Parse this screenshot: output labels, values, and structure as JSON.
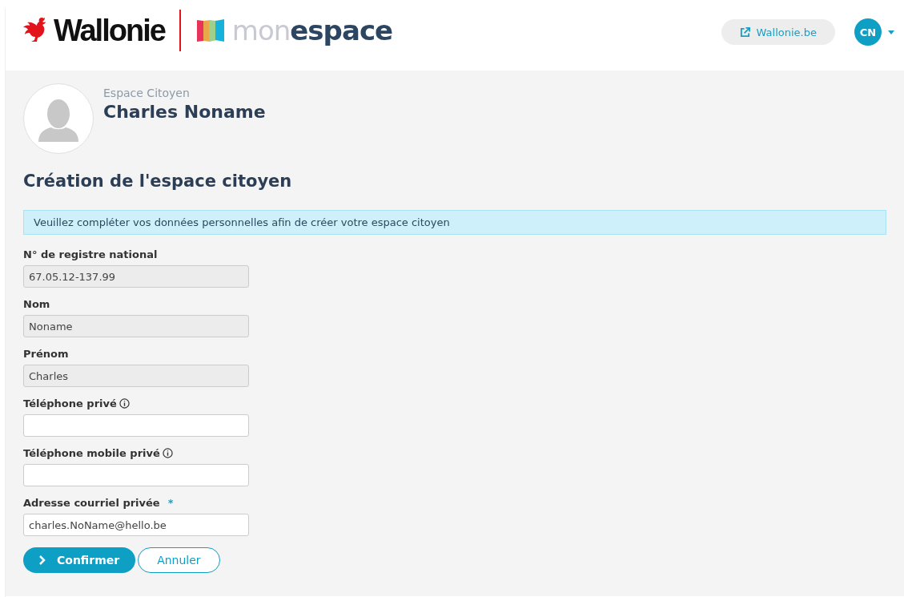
{
  "header": {
    "brand": "Wallonie",
    "app_name_light": "mon",
    "app_name_bold": "espace",
    "link": "Wallonie.be",
    "avatar": "CN"
  },
  "profile": {
    "space": "Espace Citoyen",
    "name": "Charles Noname"
  },
  "title": "Création de l'espace citoyen",
  "notice": "Veuillez compléter vos données personnelles afin de créer votre espace citoyen",
  "fields": [
    {
      "label": "N° de registre national",
      "value": "67.05.12-137.99",
      "disabled": true,
      "info": false,
      "required": false
    },
    {
      "label": "Nom",
      "value": "Noname",
      "disabled": true,
      "info": false,
      "required": false
    },
    {
      "label": "Prénom",
      "value": "Charles",
      "disabled": true,
      "info": false,
      "required": false
    },
    {
      "label": "Téléphone privé",
      "disabled": false,
      "info": true,
      "required": false
    },
    {
      "label": "Téléphone mobile privé",
      "disabled": false,
      "info": true,
      "required": false
    },
    {
      "label": "Adresse courriel privée",
      "value": "charles.NoName@hello.be",
      "disabled": false,
      "info": false,
      "required": true
    }
  ],
  "required_mark": "*",
  "buttons": [
    {
      "label": "Confirmer",
      "kind": "primary"
    },
    {
      "label": "Annuler",
      "kind": "secondary"
    }
  ]
}
